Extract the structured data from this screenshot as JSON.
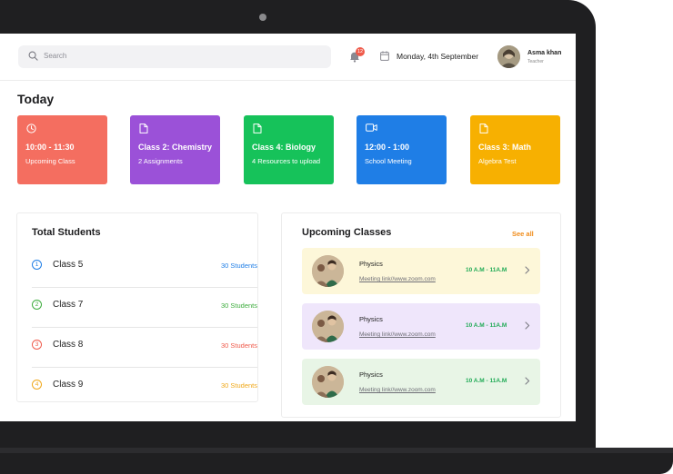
{
  "colors": {
    "bezel": "#1f1f21",
    "card_coral": "#f46e60",
    "card_purple": "#9b51d8",
    "card_green": "#16c25a",
    "card_blue": "#1f7ee6",
    "card_yellow": "#f7b001",
    "accent_orange": "#f08c1a",
    "link_green": "#1faa55",
    "row_yellow": "#fdf7d9",
    "row_purple": "#efe6fb",
    "row_green": "#e8f5e6"
  },
  "header": {
    "search_placeholder": "Search",
    "notification_count": "12",
    "date": "Monday, 4th September",
    "user": {
      "name": "Asma khan",
      "role": "Teacher"
    }
  },
  "today": {
    "title": "Today",
    "cards": [
      {
        "icon": "clock-icon",
        "title": "10:00 - 11:30",
        "subtitle": "Upcoming Class"
      },
      {
        "icon": "document-icon",
        "title": "Class 2: Chemistry",
        "subtitle": "2 Assignments"
      },
      {
        "icon": "document-icon",
        "title": "Class 4: Biology",
        "subtitle": "4 Resources to upload"
      },
      {
        "icon": "video-icon",
        "title": "12:00 - 1:00",
        "subtitle": "School Meeting"
      },
      {
        "icon": "document-icon",
        "title": "Class 3: Math",
        "subtitle": "Algebra Test"
      }
    ]
  },
  "total_students": {
    "title": "Total Students",
    "rows": [
      {
        "num": "1",
        "name": "Class 5",
        "count": "30 Students",
        "color": "#1f7ee6"
      },
      {
        "num": "2",
        "name": "Class 7",
        "count": "30 Students",
        "color": "#3dac3d"
      },
      {
        "num": "3",
        "name": "Class 8",
        "count": "30 Students",
        "color": "#ef5a4a"
      },
      {
        "num": "4",
        "name": "Class 9",
        "count": "30 Students",
        "color": "#f0a81a"
      }
    ]
  },
  "upcoming": {
    "title": "Upcoming Classes",
    "see_all": "See all",
    "rows": [
      {
        "subject": "Physics",
        "link": "Meeting link//www.zoom.com",
        "time": "10 A.M - 11A.M"
      },
      {
        "subject": "Physics",
        "link": "Meeting link//www.zoom.com",
        "time": "10 A.M - 11A.M"
      },
      {
        "subject": "Physics",
        "link": "Meeting link//www.zoom.com",
        "time": "10 A.M - 11A.M"
      }
    ]
  }
}
